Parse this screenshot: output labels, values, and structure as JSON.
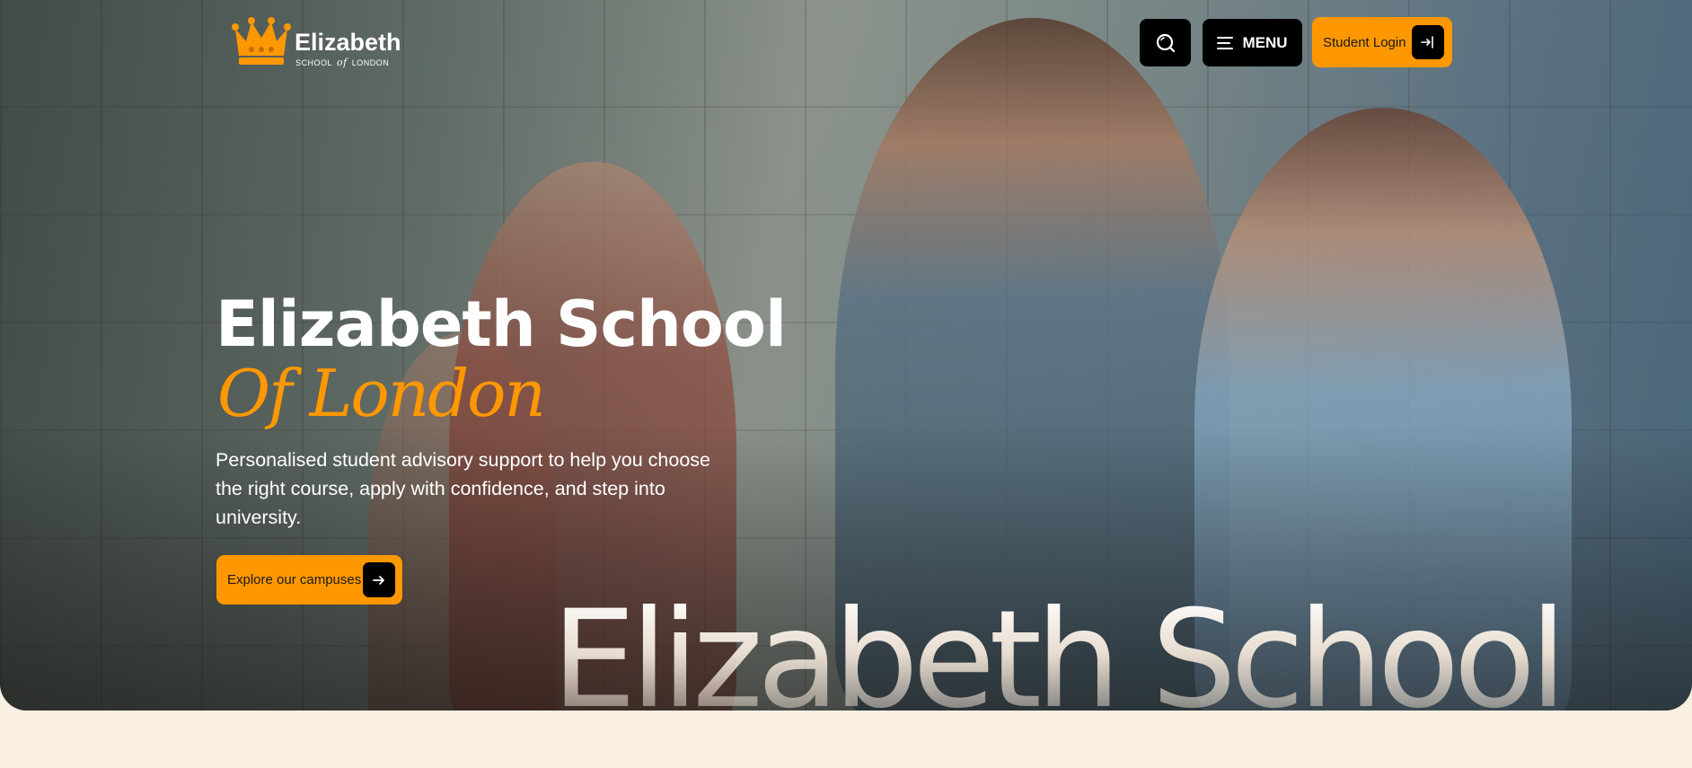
{
  "brand": {
    "name": "Elizabeth",
    "sub_left": "SCHOOL",
    "sub_mid": "of",
    "sub_right": "LONDON",
    "crown_icon": "crown-icon",
    "accent_color": "#ff9800"
  },
  "header": {
    "search_icon": "search-icon",
    "menu_label": "MENU",
    "menu_icon": "hamburger-icon",
    "login_label": "Student Login",
    "login_icon": "login-arrow-icon"
  },
  "hero": {
    "title": "Elizabeth School",
    "script_title": "Of London",
    "description": "Personalised student advisory support to help you choose the right course, apply with confidence, and step into university.",
    "cta_label": "Explore our campuses",
    "cta_icon": "arrow-right-icon",
    "watermark": "Elizabeth School"
  },
  "colors": {
    "page_background": "#faf0e1",
    "button_dark": "#000000",
    "button_accent": "#ff9800"
  }
}
